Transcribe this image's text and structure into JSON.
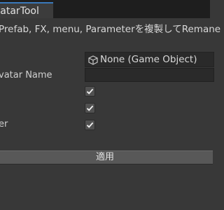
{
  "window": {
    "tab_title": "vatarTool"
  },
  "description": "Prefab, FX, menu, Parameterを複製してRemane",
  "fields": {
    "object_field": {
      "icon": "cube-icon",
      "value": "None (Game Object)"
    },
    "avatar_name": {
      "label": "vatar Name",
      "value": ""
    },
    "checkbox_1": {
      "label": "",
      "checked": true
    },
    "checkbox_2": {
      "label": "",
      "checked": true
    },
    "checkbox_3": {
      "label": "er",
      "checked": true
    }
  },
  "apply_button": {
    "label": "適用"
  },
  "colors": {
    "background": "#383838",
    "tab_accent": "#3a79bb",
    "button": "#585858",
    "field": "#2a2a2a"
  }
}
